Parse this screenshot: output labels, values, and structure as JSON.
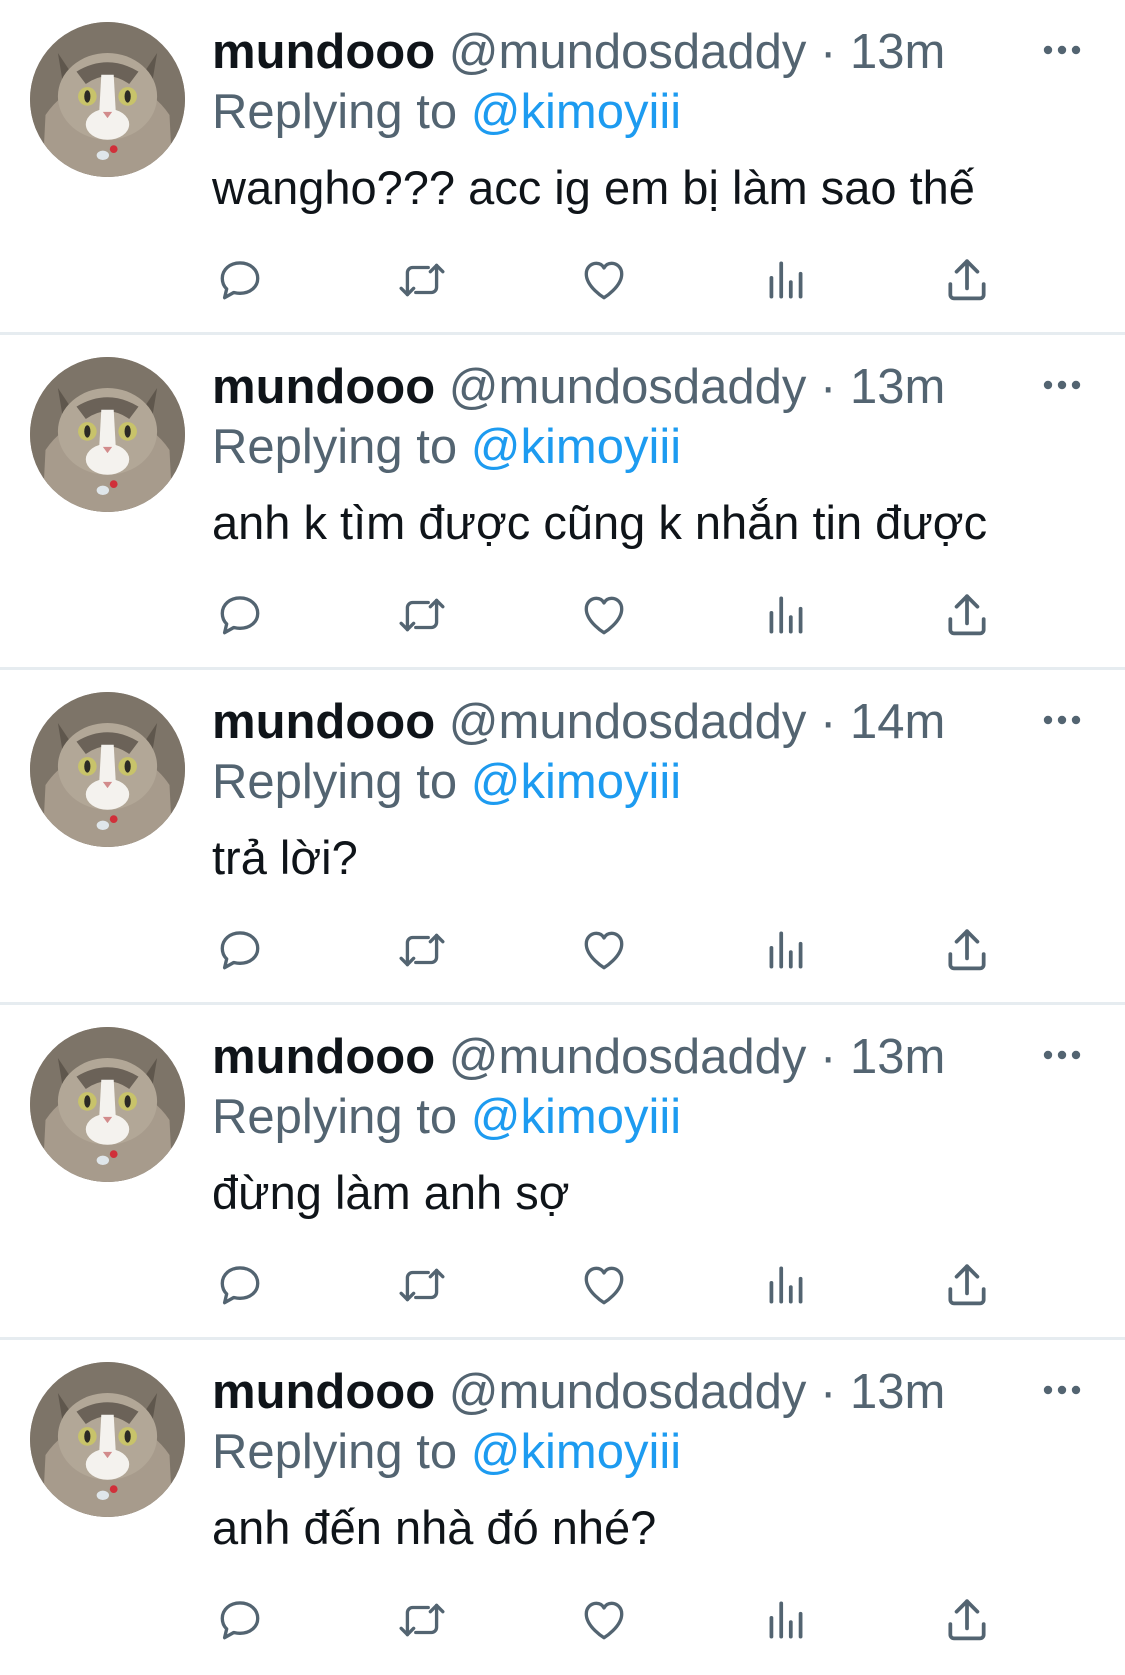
{
  "colors": {
    "accent": "#1d9bf0",
    "text": "#0f1419",
    "secondary": "#536471",
    "divider": "#e6ecf0"
  },
  "tweets": [
    {
      "name": "mundooo",
      "handle": "@mundosdaddy",
      "dot": "·",
      "time": "13m",
      "replying_prefix": "Replying to ",
      "replying_to": "@kimoyiii",
      "text": "wangho??? acc ig em bị làm sao thế"
    },
    {
      "name": "mundooo",
      "handle": "@mundosdaddy",
      "dot": "·",
      "time": "13m",
      "replying_prefix": "Replying to ",
      "replying_to": "@kimoyiii",
      "text": "anh k tìm được cũng k nhắn tin được"
    },
    {
      "name": "mundooo",
      "handle": "@mundosdaddy",
      "dot": "·",
      "time": "14m",
      "replying_prefix": "Replying to ",
      "replying_to": "@kimoyiii",
      "text": "trả lời?"
    },
    {
      "name": "mundooo",
      "handle": "@mundosdaddy",
      "dot": "·",
      "time": "13m",
      "replying_prefix": "Replying to ",
      "replying_to": "@kimoyiii",
      "text": "đừng làm anh sợ"
    },
    {
      "name": "mundooo",
      "handle": "@mundosdaddy",
      "dot": "·",
      "time": "13m",
      "replying_prefix": "Replying to ",
      "replying_to": "@kimoyiii",
      "text": "anh đến nhà đó nhé?"
    }
  ],
  "icons": {
    "avatar": "cat-avatar",
    "more": "more-horizontal-icon",
    "reply": "reply-bubble-icon",
    "retweet": "retweet-icon",
    "like": "heart-icon",
    "stats": "analytics-bars-icon",
    "share": "share-upload-icon"
  }
}
